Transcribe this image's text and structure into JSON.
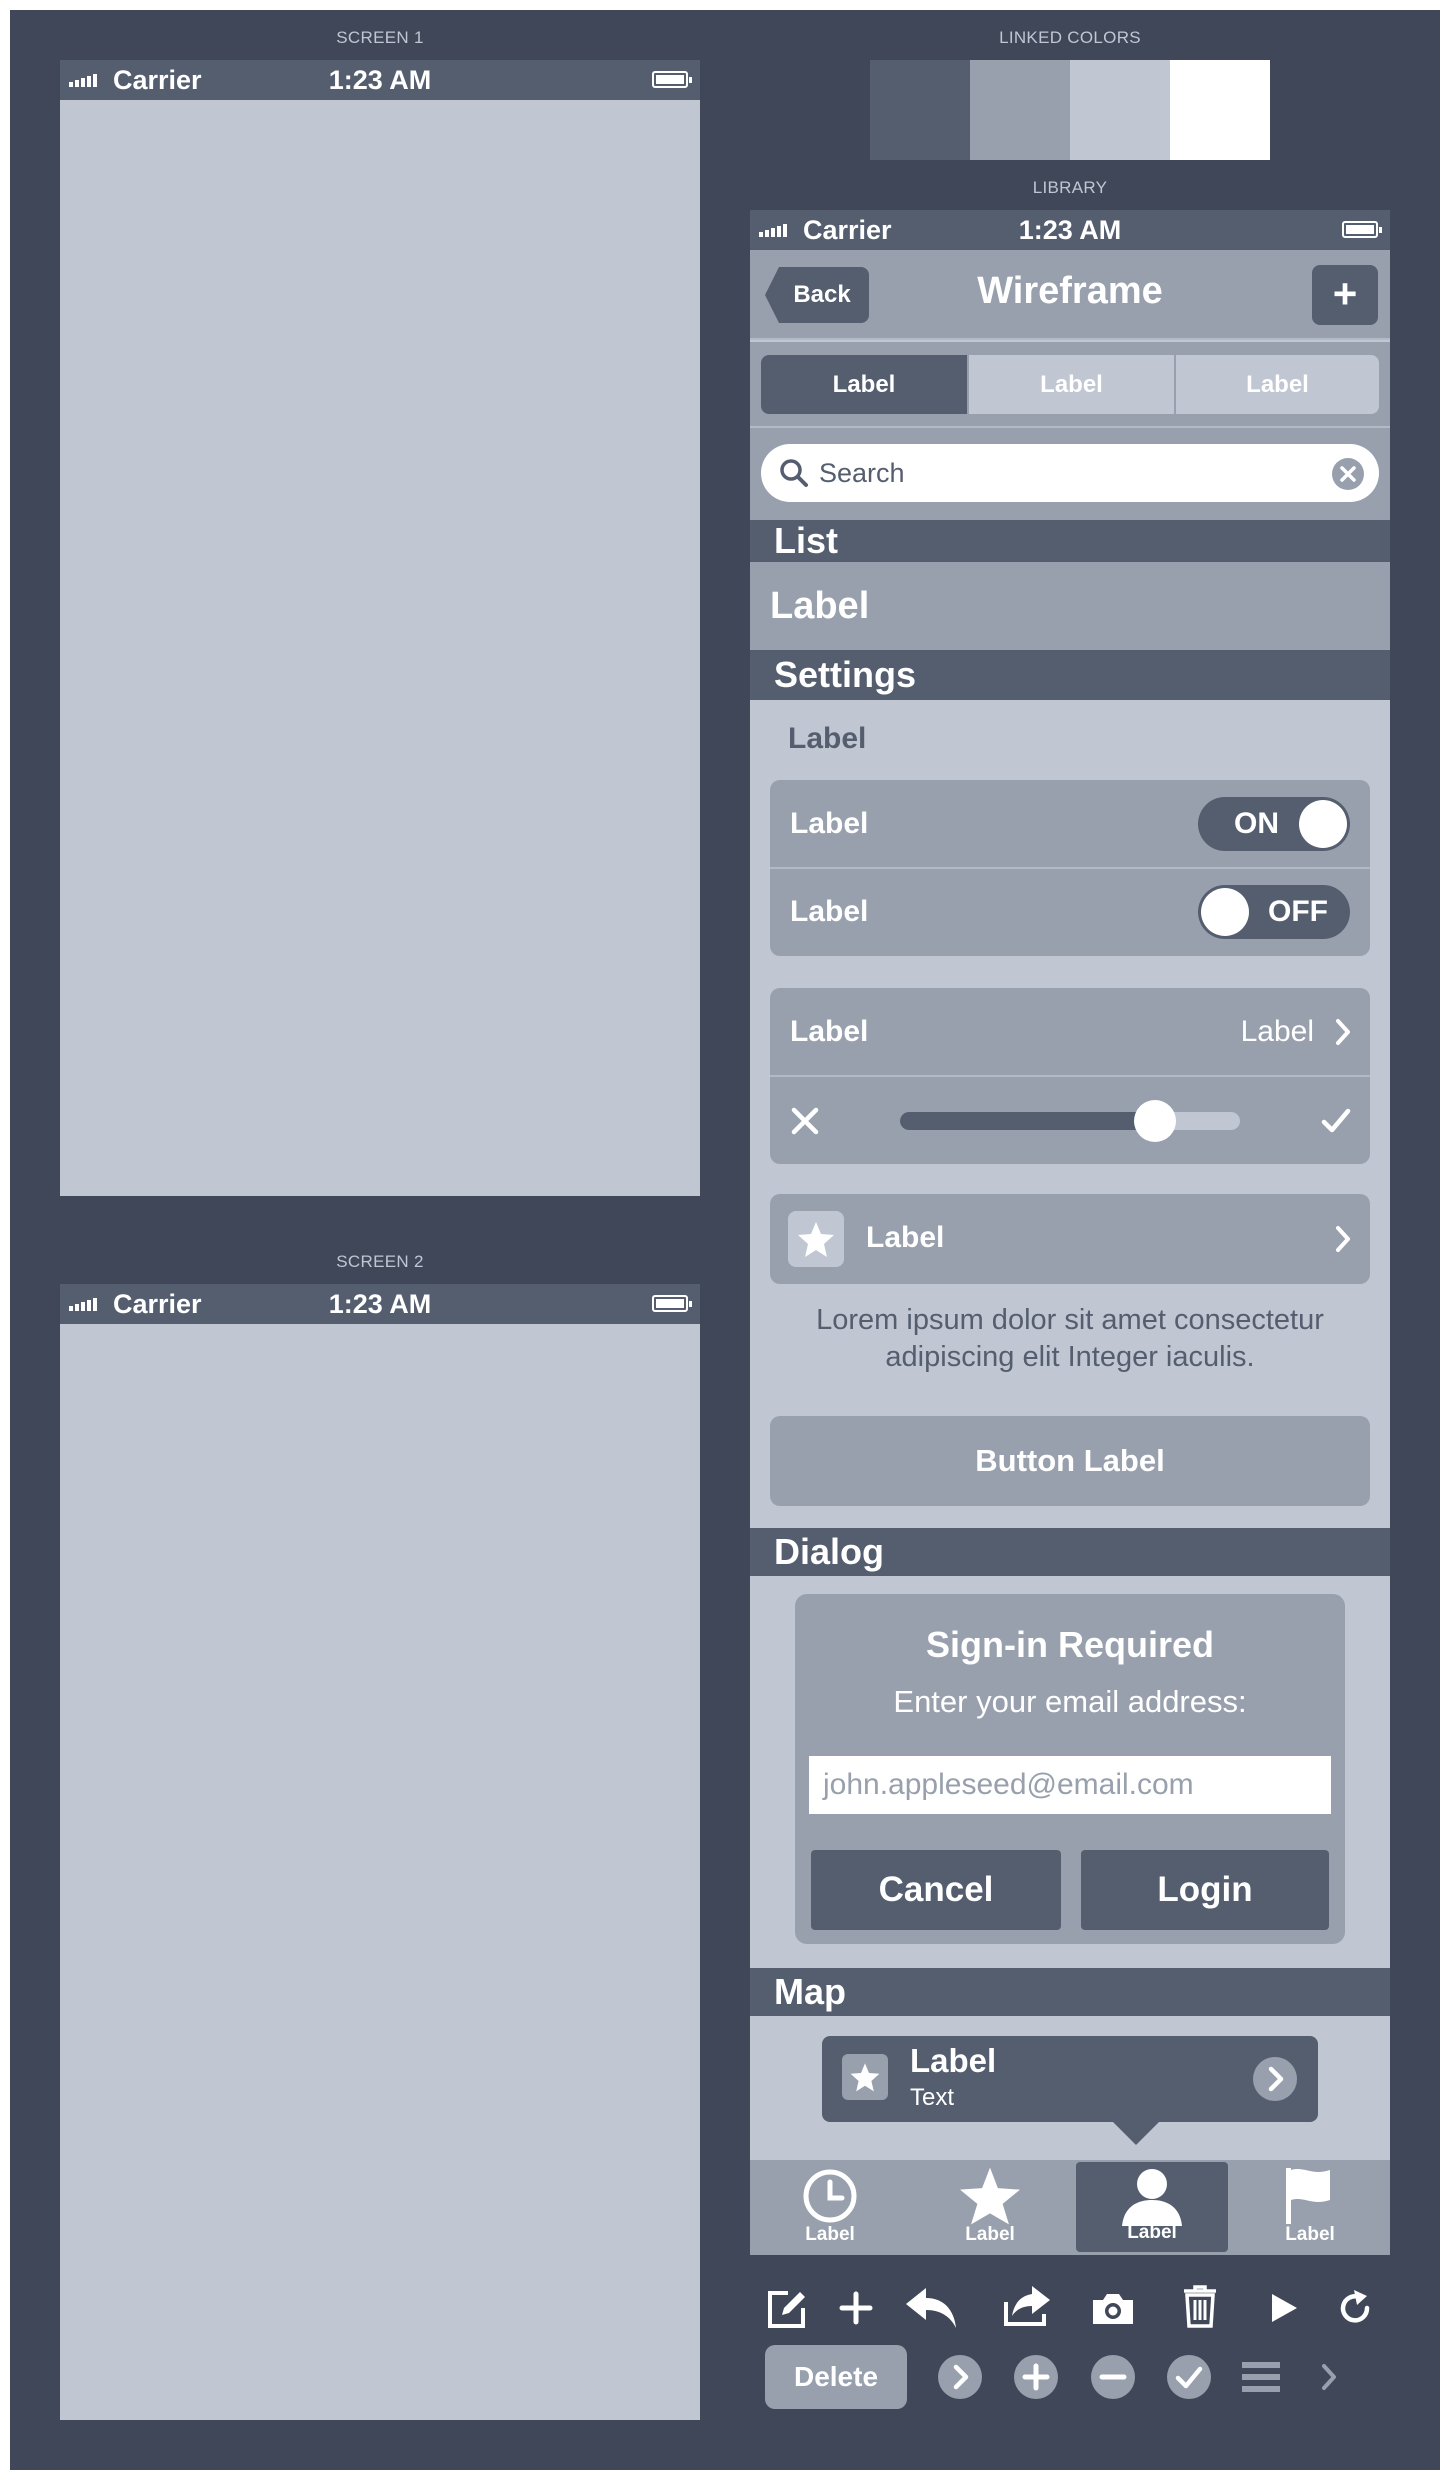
{
  "colors": {
    "dark": "#3f4758",
    "mid_dark": "#555e6f",
    "mid": "#98a0ad",
    "light": "#c1c6d3",
    "white": "#ffffff"
  },
  "screens": [
    {
      "caption": "SCREEN 1",
      "carrier": "Carrier",
      "time": "1:23 AM"
    },
    {
      "caption": "SCREEN 2",
      "carrier": "Carrier",
      "time": "1:23 AM"
    }
  ],
  "linked_colors": {
    "caption": "LINKED COLORS",
    "swatches": [
      "#555e6f",
      "#98a0ad",
      "#c1c6d3",
      "#ffffff"
    ]
  },
  "library": {
    "caption": "LIBRARY",
    "status": {
      "carrier": "Carrier",
      "time": "1:23 AM"
    },
    "navbar": {
      "back": "Back",
      "title": "Wireframe",
      "add_icon": "plus-icon"
    },
    "segments": [
      "Label",
      "Label",
      "Label"
    ],
    "search": {
      "placeholder": "Search"
    },
    "list": {
      "header": "List",
      "row": "Label"
    },
    "settings": {
      "header": "Settings",
      "group_label": "Label",
      "toggles": [
        {
          "label": "Label",
          "state": "ON"
        },
        {
          "label": "Label",
          "state": "OFF"
        }
      ],
      "detail": {
        "label": "Label",
        "value": "Label"
      },
      "slider_value": 0.75,
      "star_row": "Label",
      "lorem_line1": "Lorem ipsum dolor sit amet consectetur",
      "lorem_line2": "adipiscing elit Integer iaculis.",
      "button": "Button Label"
    },
    "dialog": {
      "header": "Dialog",
      "title": "Sign-in Required",
      "message": "Enter your email address:",
      "placeholder": "john.appleseed@email.com",
      "cancel": "Cancel",
      "login": "Login"
    },
    "map": {
      "header": "Map",
      "title": "Label",
      "subtitle": "Text"
    },
    "tabbar": [
      {
        "icon": "clock-icon",
        "label": "Label"
      },
      {
        "icon": "star-icon",
        "label": "Label"
      },
      {
        "icon": "person-icon",
        "label": "Label",
        "selected": true
      },
      {
        "icon": "flag-icon",
        "label": "Label"
      }
    ]
  },
  "toolbar": {
    "icons": [
      "compose-icon",
      "plus-icon",
      "reply-icon",
      "share-icon",
      "camera-icon",
      "trash-icon",
      "play-icon",
      "refresh-icon"
    ],
    "delete": "Delete",
    "circle_icons": [
      "chevron-right-circle-icon",
      "plus-circle-icon",
      "minus-circle-icon",
      "check-circle-icon",
      "menu-icon",
      "chevron-right-icon"
    ]
  }
}
